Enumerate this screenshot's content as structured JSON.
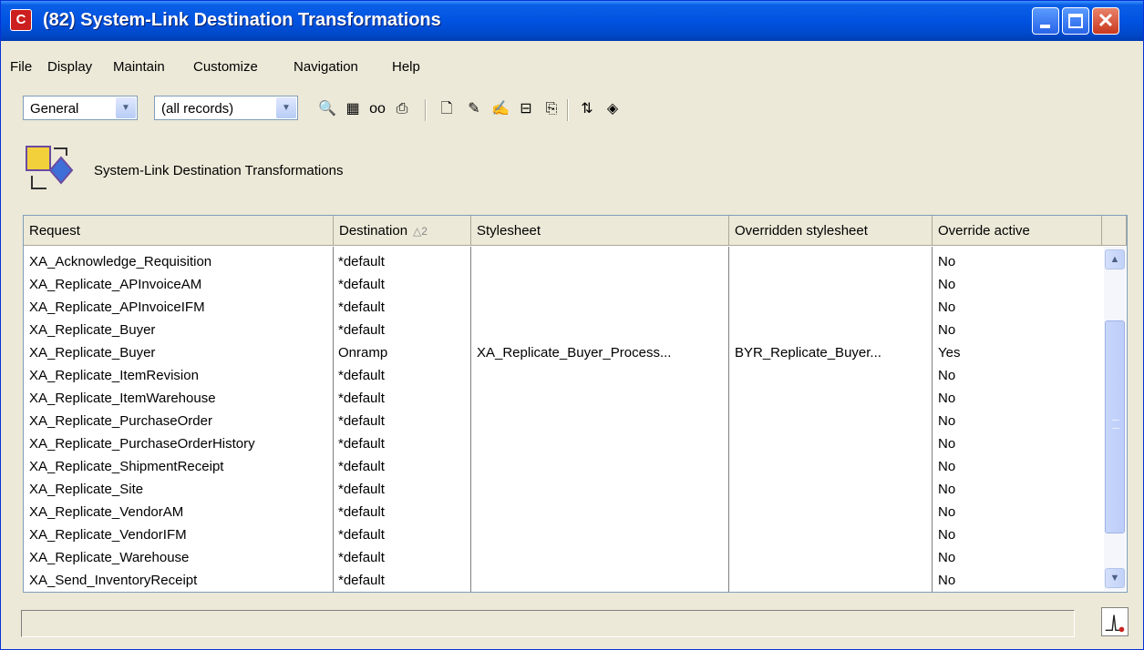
{
  "window": {
    "title": "(82) System-Link Destination Transformations",
    "app_icon_letter": "C",
    "controls": {
      "minimize": "minimize",
      "maximize": "maximize",
      "close": "✕"
    }
  },
  "menu": [
    "File",
    "Display",
    "Maintain",
    "Customize",
    "Navigation",
    "Help"
  ],
  "toolbar": {
    "view_select": "General",
    "filter_select": "(all records)",
    "icons": [
      "binoculars-icon",
      "search-results-icon",
      "glasses-icon",
      "print-icon",
      "new-icon",
      "edit-pencil-icon",
      "edit-list-icon",
      "tree-icon",
      "copy-icon",
      "import-export-icon",
      "xml-icon"
    ]
  },
  "header": {
    "title": "System-Link Destination Transformations"
  },
  "grid": {
    "columns": [
      "Request",
      "Destination",
      "Stylesheet",
      "Overridden stylesheet",
      "Override active"
    ],
    "sort_indicator": "2",
    "rows": [
      [
        "XA_Acknowledge_Requisition",
        "*default",
        "",
        "",
        "No"
      ],
      [
        "XA_Replicate_APInvoiceAM",
        "*default",
        "",
        "",
        "No"
      ],
      [
        "XA_Replicate_APInvoiceIFM",
        "*default",
        "",
        "",
        "No"
      ],
      [
        "XA_Replicate_Buyer",
        "*default",
        "",
        "",
        "No"
      ],
      [
        "XA_Replicate_Buyer",
        "Onramp",
        "XA_Replicate_Buyer_Process...",
        "BYR_Replicate_Buyer...",
        "Yes"
      ],
      [
        "XA_Replicate_ItemRevision",
        "*default",
        "",
        "",
        "No"
      ],
      [
        "XA_Replicate_ItemWarehouse",
        "*default",
        "",
        "",
        "No"
      ],
      [
        "XA_Replicate_PurchaseOrder",
        "*default",
        "",
        "",
        "No"
      ],
      [
        "XA_Replicate_PurchaseOrderHistory",
        "*default",
        "",
        "",
        "No"
      ],
      [
        "XA_Replicate_ShipmentReceipt",
        "*default",
        "",
        "",
        "No"
      ],
      [
        "XA_Replicate_Site",
        "*default",
        "",
        "",
        "No"
      ],
      [
        "XA_Replicate_VendorAM",
        "*default",
        "",
        "",
        "No"
      ],
      [
        "XA_Replicate_VendorIFM",
        "*default",
        "",
        "",
        "No"
      ],
      [
        "XA_Replicate_Warehouse",
        "*default",
        "",
        "",
        "No"
      ],
      [
        "XA_Send_InventoryReceipt",
        "*default",
        "",
        "",
        "No"
      ]
    ]
  },
  "status": {
    "text": ""
  }
}
